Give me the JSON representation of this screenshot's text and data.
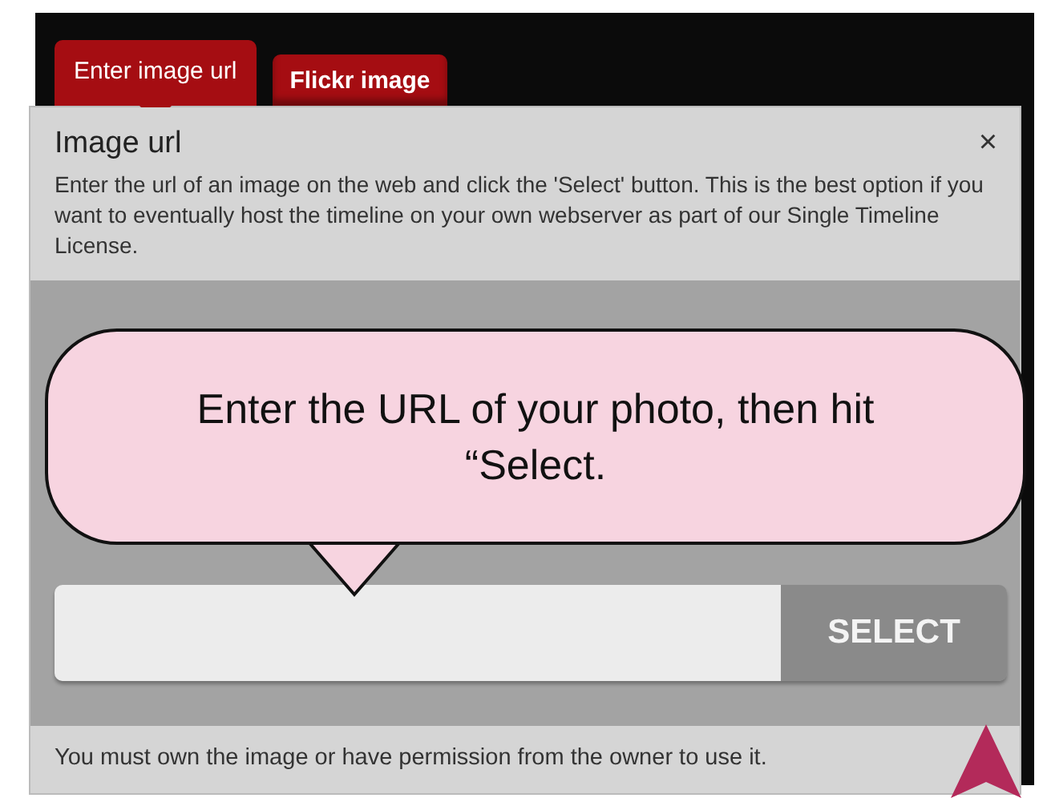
{
  "tabs": [
    {
      "label": "Enter image url",
      "selected": true
    },
    {
      "label": "Flickr image",
      "selected": false
    }
  ],
  "dialog": {
    "title": "Image url",
    "close": "×",
    "description": "Enter the url of an image on the web and click the 'Select' button. This is the best option if you want to eventually host the timeline on your own webserver as part of our Single Timeline License.",
    "select_button": "SELECT",
    "footer": "You must own the image or have permission from the owner to use it."
  },
  "callout": {
    "text": "Enter the URL of your photo, then hit “Select."
  }
}
